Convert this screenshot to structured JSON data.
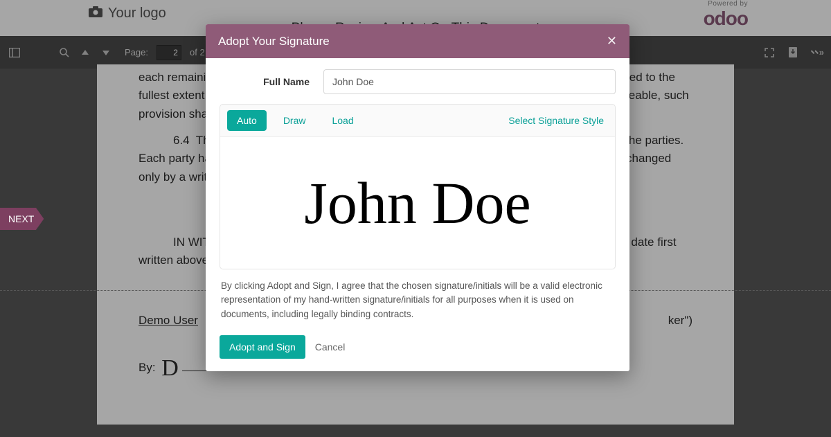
{
  "header": {
    "logo_text": "Your logo",
    "page_title": "Please Review And Act On This Document",
    "powered_label": "Powered by",
    "brand": "odoo"
  },
  "toolbar": {
    "page_label": "Page:",
    "page_current": "2",
    "page_of": "of 2"
  },
  "next_label": "NEXT",
  "document": {
    "p1": "each remaining provision of this Agreement shall be valid and enforceable, and shall be enforced to the fullest extent permitted by law. If any provision of this Agreement is so broad as to be unenforceable, such provision shall be interpreted to be only so broad as is enforceable.",
    "p2_num": "6.4",
    "p2": "This Agreement and each party's obligations shall be binding on the date between the parties. Each party has signed this Agreement through its authorized agent of this Agreement may be changed only by a writing signed by both parties and incorporating this Agreement by reference.",
    "witness": "IN WITNESS WHEREOF, the parties have entered into this Agreement signed as of the date first written above.",
    "sig_label": "Demo User",
    "by_label": "By:",
    "role_hint": "ker\")"
  },
  "modal": {
    "title": "Adopt Your Signature",
    "fullname_label": "Full Name",
    "fullname_value": "John Doe",
    "tabs": {
      "auto": "Auto",
      "draw": "Draw",
      "load": "Load"
    },
    "style_link": "Select Signature Style",
    "signature_text": "John Doe",
    "legal_text": "By clicking Adopt and Sign, I agree that the chosen signature/initials will be a valid electronic representation of my hand-written signature/initials for all purposes when it is used on documents, including legally binding contracts.",
    "adopt_btn": "Adopt and Sign",
    "cancel_btn": "Cancel"
  }
}
